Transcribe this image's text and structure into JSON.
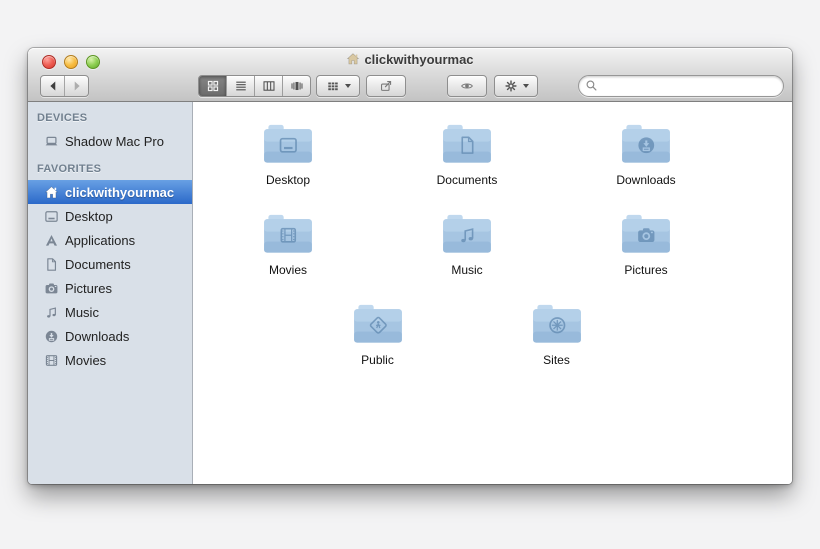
{
  "window": {
    "title": "clickwithyourmac",
    "title_icon": "home"
  },
  "toolbar": {
    "back_icon": "chevron-left",
    "forward_icon": "chevron-right",
    "view_segments": [
      {
        "name": "icon-view",
        "icon": "icon-view",
        "selected": true
      },
      {
        "name": "list-view",
        "icon": "list-view",
        "selected": false
      },
      {
        "name": "column-view",
        "icon": "column-view",
        "selected": false
      },
      {
        "name": "coverflow-view",
        "icon": "coverflow-view",
        "selected": false
      }
    ],
    "arrange_icon": "arrange-grid",
    "share_icon": "share",
    "quicklook_icon": "eye",
    "action_icon": "gear",
    "search": {
      "placeholder": "",
      "icon": "magnifier"
    }
  },
  "sidebar": {
    "sections": [
      {
        "header": "DEVICES",
        "items": [
          {
            "label": "Shadow Mac Pro",
            "icon": "laptop",
            "selected": false
          }
        ]
      },
      {
        "header": "FAVORITES",
        "items": [
          {
            "label": "clickwithyourmac",
            "icon": "home",
            "selected": true
          },
          {
            "label": "Desktop",
            "icon": "desktop",
            "selected": false
          },
          {
            "label": "Applications",
            "icon": "applications",
            "selected": false
          },
          {
            "label": "Documents",
            "icon": "document",
            "selected": false
          },
          {
            "label": "Pictures",
            "icon": "camera",
            "selected": false
          },
          {
            "label": "Music",
            "icon": "music-note",
            "selected": false
          },
          {
            "label": "Downloads",
            "icon": "download",
            "selected": false
          },
          {
            "label": "Movies",
            "icon": "film",
            "selected": false
          }
        ]
      }
    ]
  },
  "content": {
    "folders": [
      {
        "label": "Desktop",
        "glyph": "desktop"
      },
      {
        "label": "Documents",
        "glyph": "document"
      },
      {
        "label": "Downloads",
        "glyph": "download"
      },
      {
        "label": "Movies",
        "glyph": "film"
      },
      {
        "label": "Music",
        "glyph": "music-note"
      },
      {
        "label": "Pictures",
        "glyph": "camera"
      },
      {
        "label": "Public",
        "glyph": "public"
      },
      {
        "label": "Sites",
        "glyph": "compass"
      }
    ]
  },
  "colors": {
    "selection_top": "#68a0e4",
    "selection_bottom": "#2b69c9",
    "sidebar_bg": "#d9e0e8",
    "folder_light": "#c0d8ee",
    "folder_mid": "#a6c5e2",
    "folder_dark": "#90b4d7",
    "folder_glyph": "#5d86ae",
    "sidebar_icon": "#7b8694",
    "title_house": "#d9c8a2"
  }
}
